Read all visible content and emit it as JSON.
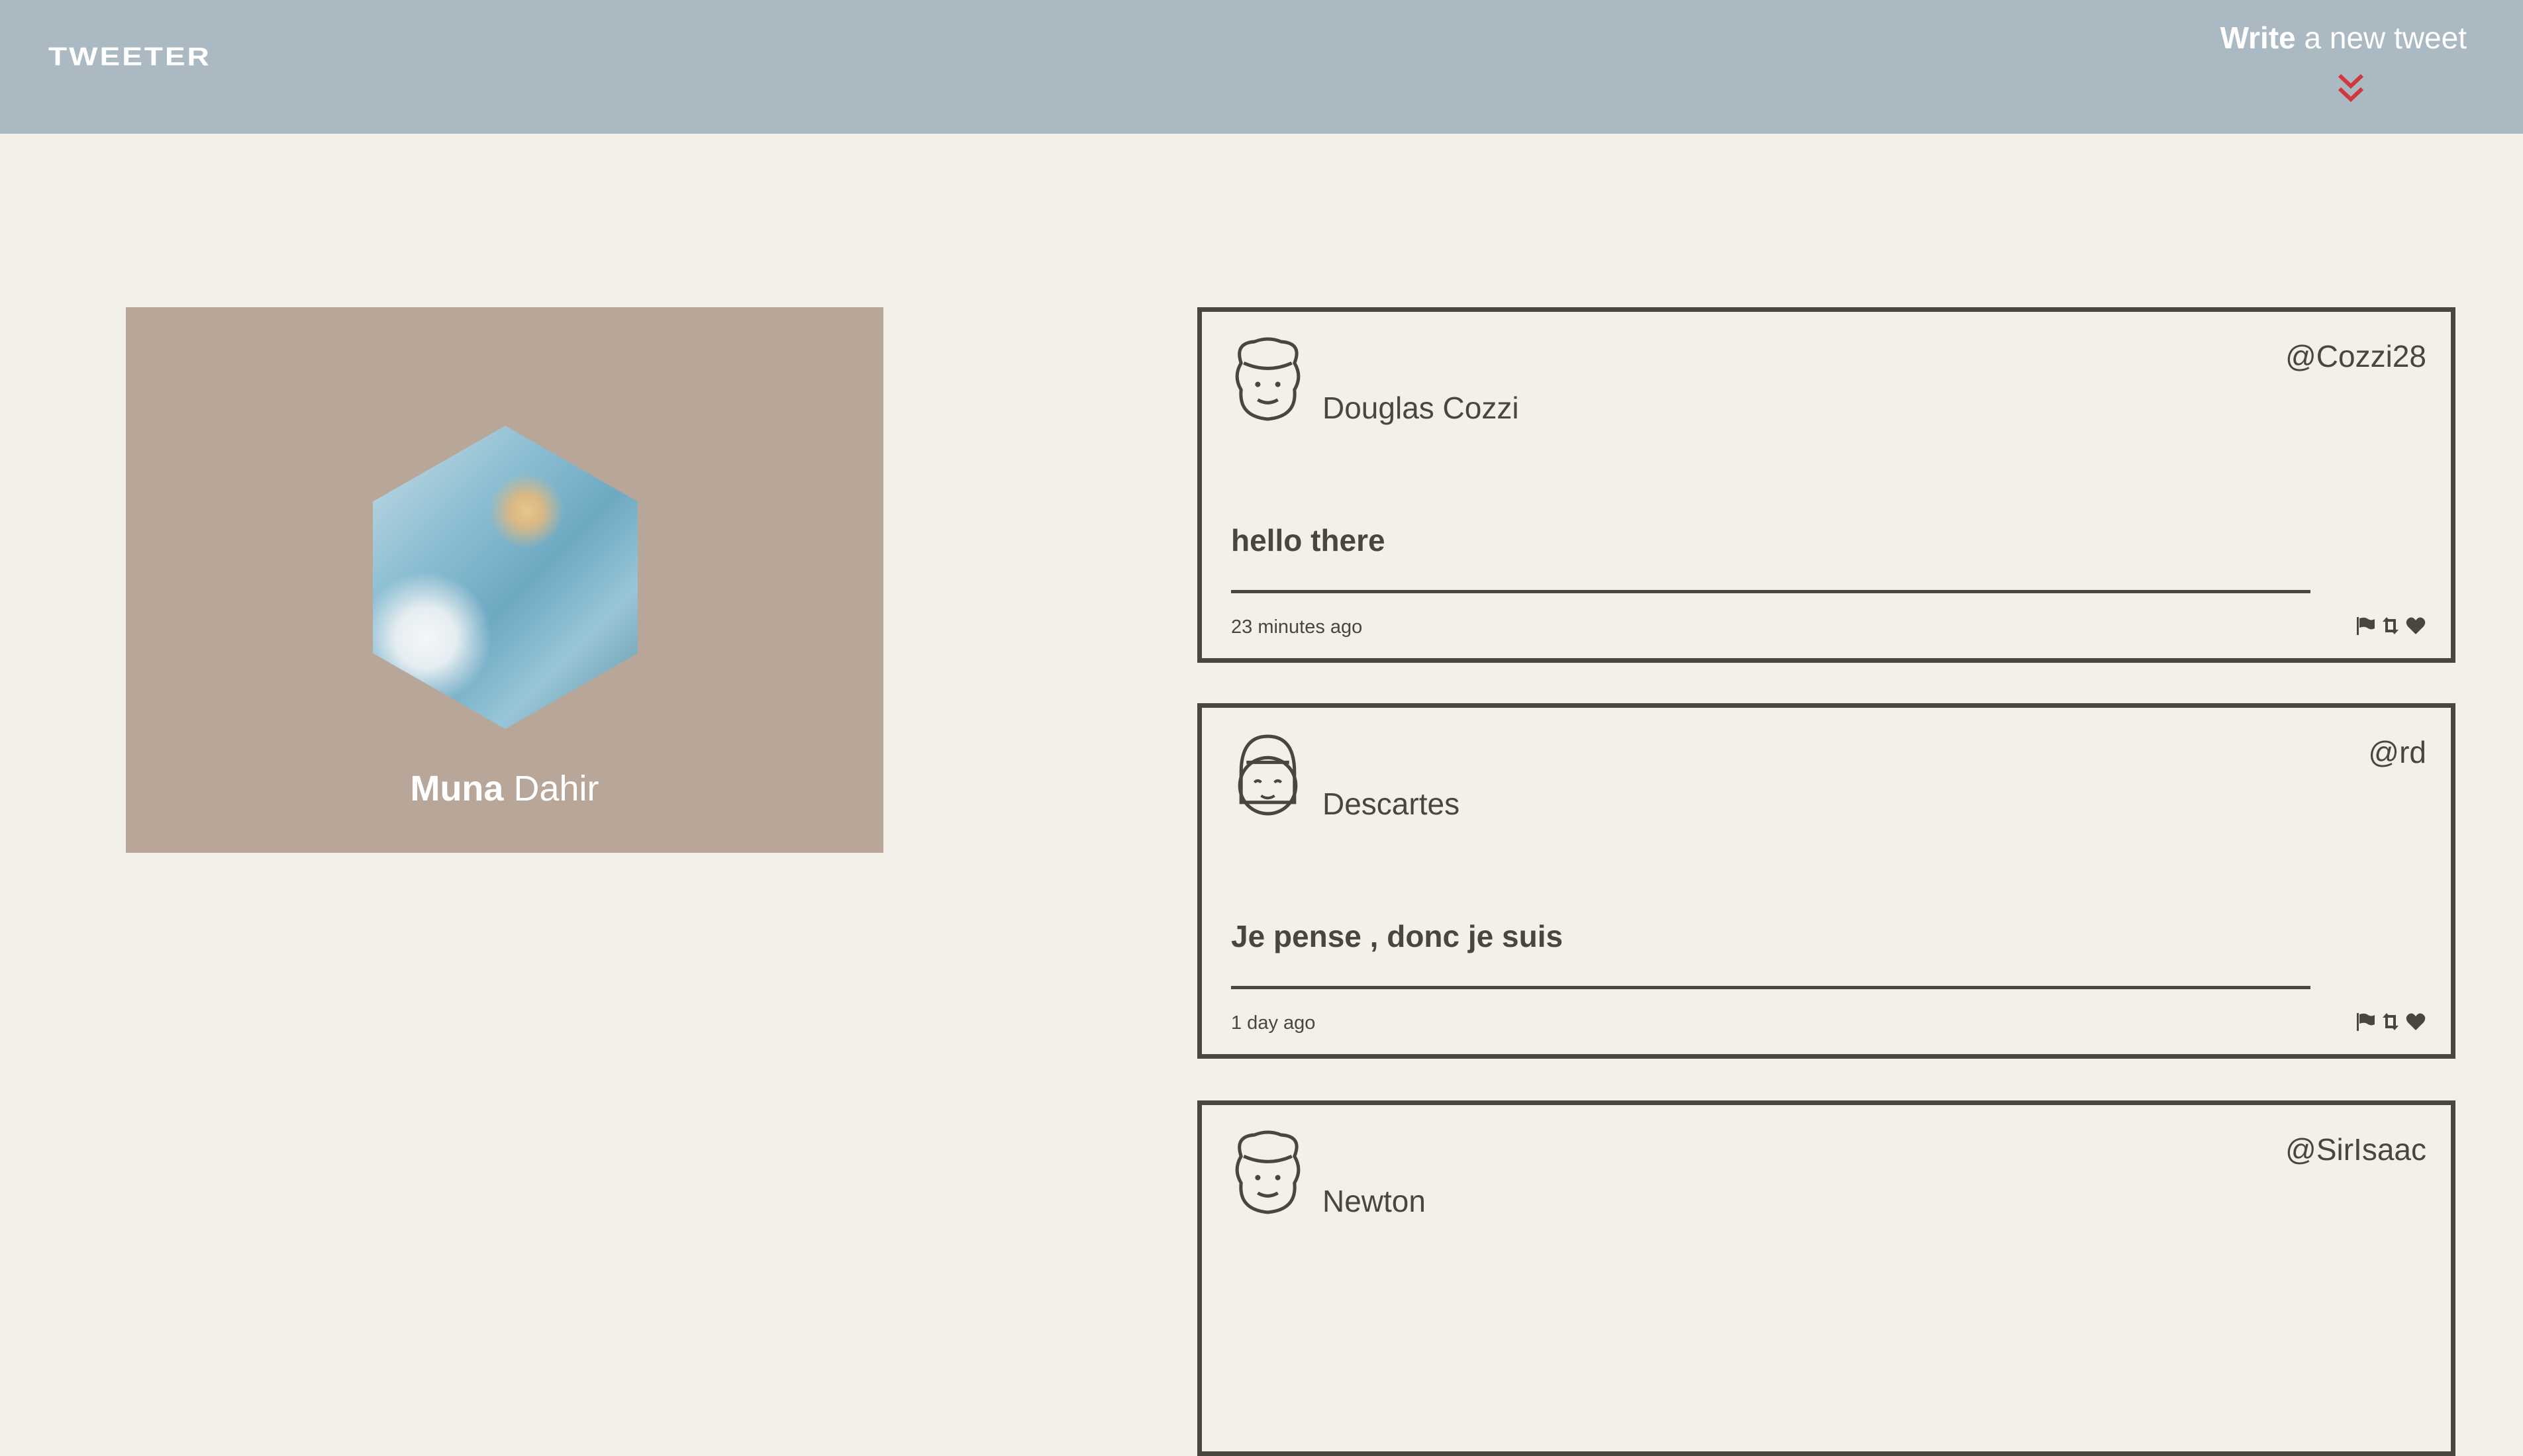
{
  "header": {
    "logo": "TWEETER",
    "compose_bold": "Write",
    "compose_rest": " a new tweet",
    "compose_icon": "double-chevron-down-icon",
    "accent": "#d0383f"
  },
  "profile": {
    "first_name": "Muna",
    "last_name": " Dahir"
  },
  "tweets": [
    {
      "name": "Douglas Cozzi",
      "handle": "@Cozzi28",
      "text": "hello there",
      "time": "23 minutes ago",
      "avatar": "curly-hair-face"
    },
    {
      "name": "Descartes",
      "handle": "@rd",
      "text": "Je pense , donc je suis",
      "time": "1 day ago",
      "avatar": "bob-hair-face"
    },
    {
      "name": "Newton",
      "handle": "@SirIsaac",
      "text": "",
      "time": "",
      "avatar": "curly-hair-face"
    }
  ],
  "icons": [
    "flag-icon",
    "retweet-icon",
    "heart-icon"
  ]
}
